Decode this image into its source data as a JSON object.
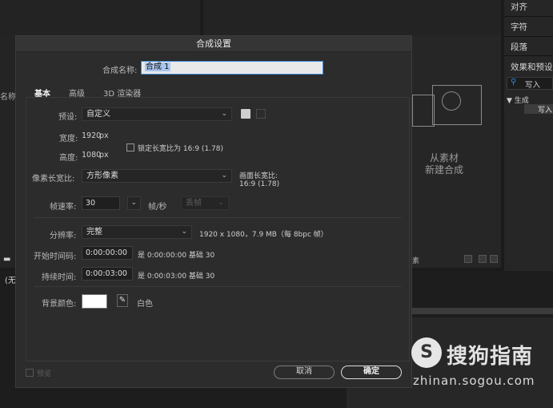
{
  "background": {
    "right_panel": [
      "对齐",
      "字符",
      "段落",
      "效果和预设"
    ],
    "effects_search": "写入",
    "tree_group": "▼ 生成",
    "tree_item": "写入",
    "left_label": "名称",
    "left_fragment": "(无",
    "source_text": "从素材",
    "source_text2": "新建合成",
    "px_fragment": "素"
  },
  "dialog": {
    "title": "合成设置",
    "name_label": "合成名称:",
    "name_value": "合成 1",
    "tabs": [
      "基本",
      "高级",
      "3D 渲染器"
    ],
    "preset_label": "预设:",
    "preset_value": "自定义",
    "width_label": "宽度:",
    "width_value": "1920",
    "height_label": "高度:",
    "height_value": "1080",
    "px": "px",
    "lock_label": "锁定长宽比为 16:9 (1.78)",
    "pixel_aspect_label": "像素长宽比:",
    "pixel_aspect_value": "方形像素",
    "frame_aspect_label": "画面长宽比:",
    "frame_aspect_value": "16:9 (1.78)",
    "frame_rate_label": "帧速率:",
    "frame_rate_value": "30",
    "fps_unit": "帧/秒",
    "drop_frame": "丢帧",
    "resolution_label": "分辨率:",
    "resolution_value": "完整",
    "resolution_info": "1920 x 1080，7.9 MB（每 8bpc 帧）",
    "start_tc_label": "开始时间码:",
    "start_tc_value": "0:00:00:00",
    "start_tc_info": "是 0:00:00:00  基础 30",
    "duration_label": "持续时间:",
    "duration_value": "0:00:03:00",
    "duration_info": "是 0:00:03:00  基础 30",
    "bg_color_label": "背景颜色:",
    "bg_color_name": "白色",
    "bg_color": "#ffffff",
    "preview_label": "预览",
    "cancel_label": "取消",
    "ok_label": "确定"
  },
  "watermark": {
    "logo": "S",
    "text": "搜狗指南",
    "url": "zhinan.sogou.com"
  }
}
